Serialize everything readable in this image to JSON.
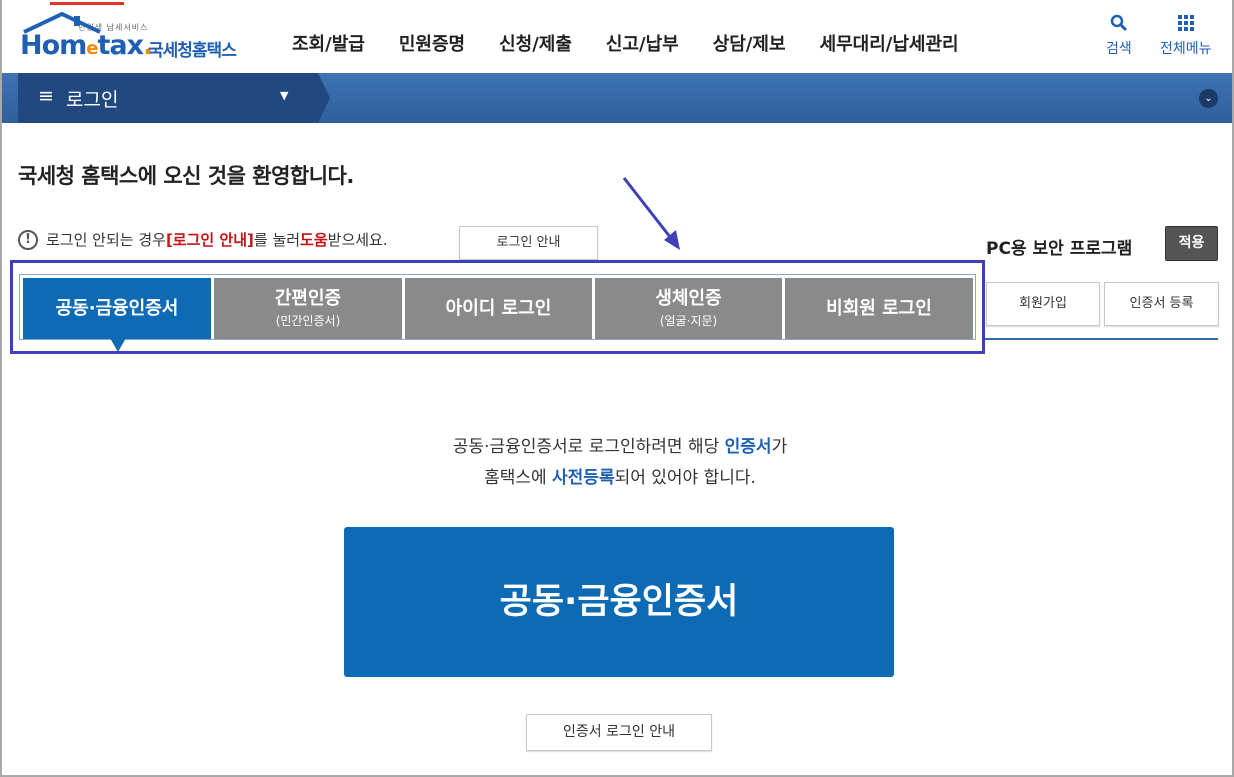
{
  "header": {
    "logo_tag": "민원생 납세서비스",
    "logo_word": "Hometax",
    "logo_kr": "국세청홈택스",
    "nav": [
      "조회/발급",
      "민원증명",
      "신청/제출",
      "신고/납부",
      "상담/제보",
      "세무대리/납세관리"
    ],
    "search_label": "검색",
    "menu_label": "전체메뉴"
  },
  "band": {
    "label": "로그인"
  },
  "main": {
    "welcome": "국세청 홈택스에 오신 것을 환영합니다.",
    "notice_a": "로그인 안되는 경우 ",
    "notice_b": "[로그인 안내]",
    "notice_c": "를 눌러 ",
    "notice_d": "도움",
    "notice_e": "받으세요.",
    "login_guide": "로그인 안내",
    "pc_security": "PC용 보안 프로그램",
    "apply": "적용",
    "signup": "회원가입",
    "cert_register": "인증서 등록"
  },
  "tabs": [
    {
      "label": "공동·금융인증서",
      "sub": ""
    },
    {
      "label": "간편인증",
      "sub": "(민간인증서)"
    },
    {
      "label": "아이디 로그인",
      "sub": ""
    },
    {
      "label": "생체인증",
      "sub": "(얼굴·지문)"
    },
    {
      "label": "비회원 로그인",
      "sub": ""
    }
  ],
  "desc": {
    "l1a": "공동·금융인증서로 로그인하려면 해당 ",
    "l1b": "인증서",
    "l1c": "가",
    "l2a": "홈택스에 ",
    "l2b": "사전등록",
    "l2c": "되어 있어야 합니다."
  },
  "big_button": "공동·금융인증서",
  "cert_login_guide": "인증서 로그인 안내",
  "colors": {
    "primary": "#0d6bb5",
    "tab_inactive": "#8a8a8a",
    "outline": "#3f3fb8"
  }
}
